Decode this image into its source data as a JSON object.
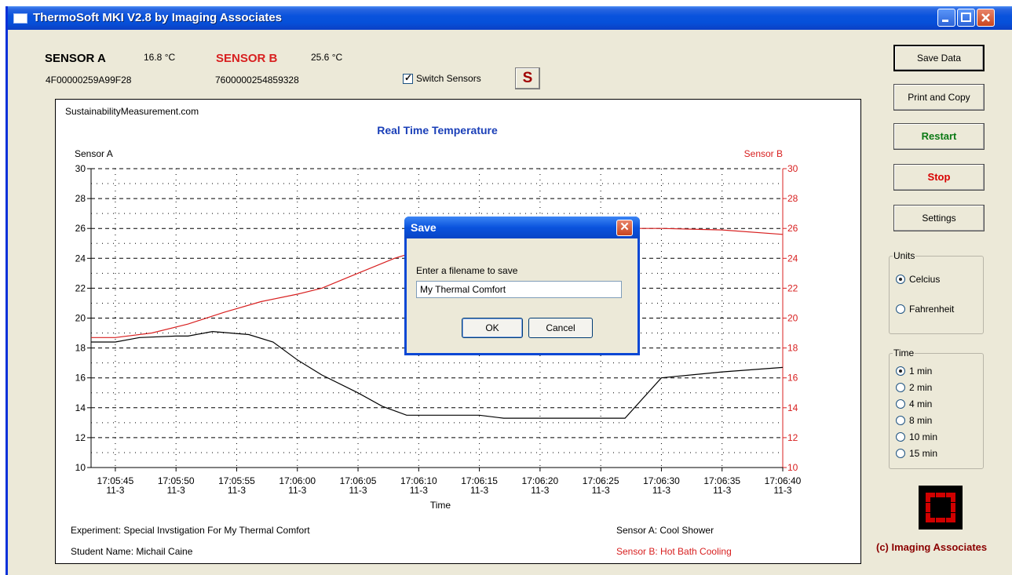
{
  "window": {
    "title": "ThermoSoft  MKI V2.8 by Imaging Associates"
  },
  "sensors": {
    "a": {
      "name": "SENSOR A",
      "value": "16.8 °C",
      "id": "4F00000259A99F28"
    },
    "b": {
      "name": "SENSOR B",
      "value": "25.6 °C",
      "id": "7600000254859328"
    }
  },
  "switch_sensors": {
    "label": "Switch Sensors",
    "checked": true
  },
  "s_button": {
    "label": "S"
  },
  "buttons": {
    "save": "Save Data",
    "print": "Print and Copy",
    "restart": "Restart",
    "stop": "Stop",
    "settings": "Settings"
  },
  "units": {
    "title": "Units",
    "options": [
      "Celcius",
      "Fahrenheit"
    ],
    "selected": "Celcius"
  },
  "time": {
    "title": "Time",
    "options": [
      "1 min",
      "2 min",
      "4 min",
      "8 min",
      "10 min",
      "15 min"
    ],
    "selected": "1 min"
  },
  "copyright": "(c) Imaging Associates",
  "chart_header": {
    "site": "SustainabilityMeasurement.com"
  },
  "footer": {
    "experiment": "Experiment: Special Invstigation For My Thermal Comfort",
    "student": "Student Name: Michail Caine",
    "sensor_a_label": "Sensor A: Cool Shower",
    "sensor_b_label": "Sensor B: Hot Bath Cooling"
  },
  "colors": {
    "sensor_a": "#000000",
    "sensor_b": "#d82020",
    "title": "#1a3fb8",
    "restart": "#0c7a16",
    "stop": "#d80000"
  },
  "dialog": {
    "title": "Save",
    "prompt": "Enter a filename to save",
    "value": "My Thermal Comfort",
    "ok": "OK",
    "cancel": "Cancel"
  },
  "chart_data": {
    "type": "line",
    "title": "Real Time Temperature",
    "xlabel": "Time",
    "ylabel_left": "Sensor A",
    "ylabel_right": "Sensor B",
    "ylim": [
      10,
      30
    ],
    "y_ticks": [
      10,
      12,
      14,
      16,
      18,
      20,
      22,
      24,
      26,
      28,
      30
    ],
    "x_ticks": [
      "17:05:45",
      "17:05:50",
      "17:05:55",
      "17:06:00",
      "17:06:05",
      "17:06:10",
      "17:06:15",
      "17:06:20",
      "17:06:25",
      "17:06:30",
      "17:06:35",
      "17:06:40"
    ],
    "x_tick_sublabel": "11-3",
    "xlim": [
      "17:05:43",
      "17:06:40"
    ],
    "grid": "dashed major, dotted minor",
    "series": [
      {
        "name": "Sensor A",
        "color": "#000000",
        "points": [
          [
            "17:05:43",
            18.4
          ],
          [
            "17:05:45",
            18.4
          ],
          [
            "17:05:47",
            18.7
          ],
          [
            "17:05:50",
            18.8
          ],
          [
            "17:05:51",
            18.8
          ],
          [
            "17:05:53",
            19.1
          ],
          [
            "17:05:56",
            18.9
          ],
          [
            "17:05:58",
            18.4
          ],
          [
            "17:06:00",
            17.2
          ],
          [
            "17:06:02",
            16.2
          ],
          [
            "17:06:05",
            15.0
          ],
          [
            "17:06:07",
            14.1
          ],
          [
            "17:06:09",
            13.5
          ],
          [
            "17:06:15",
            13.5
          ],
          [
            "17:06:17",
            13.3
          ],
          [
            "17:06:27",
            13.3
          ],
          [
            "17:06:30",
            16.0
          ],
          [
            "17:06:35",
            16.4
          ],
          [
            "17:06:40",
            16.7
          ]
        ]
      },
      {
        "name": "Sensor B",
        "color": "#d82020",
        "points": [
          [
            "17:05:43",
            18.7
          ],
          [
            "17:05:45",
            18.7
          ],
          [
            "17:05:48",
            19.0
          ],
          [
            "17:05:51",
            19.6
          ],
          [
            "17:05:54",
            20.4
          ],
          [
            "17:05:57",
            21.1
          ],
          [
            "17:06:00",
            21.6
          ],
          [
            "17:06:02",
            22.0
          ],
          [
            "17:06:05",
            23.0
          ],
          [
            "17:06:08",
            24.0
          ],
          [
            "17:06:10",
            24.5
          ],
          [
            "17:06:25",
            26.1
          ],
          [
            "17:06:27",
            26.0
          ],
          [
            "17:06:30",
            26.0
          ],
          [
            "17:06:35",
            25.9
          ],
          [
            "17:06:40",
            25.6
          ]
        ]
      }
    ]
  }
}
